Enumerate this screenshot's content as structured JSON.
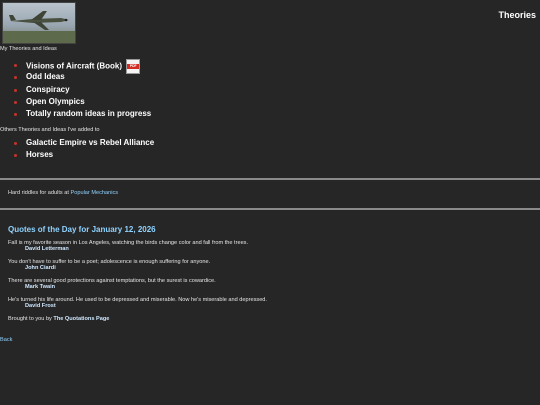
{
  "header": {
    "title": "Theories"
  },
  "my_section": {
    "label": "My Theories and Ideas",
    "items": [
      {
        "label": "Visions of Aircraft (Book)",
        "icon": "pdf-icon"
      },
      {
        "label": "Odd Ideas"
      },
      {
        "label": "Conspiracy"
      },
      {
        "label": "Open Olympics"
      },
      {
        "label": "Totally random ideas in progress"
      }
    ]
  },
  "others_section": {
    "label": "Others Theories and Ideas I've added to",
    "items": [
      {
        "label": "Galactic Empire vs Rebel Alliance"
      },
      {
        "label": "Horses"
      }
    ]
  },
  "riddles": {
    "prefix": "Hard riddles for adults at ",
    "link": "Popular Mechanics"
  },
  "quotes": {
    "title": "Quotes of the Day for January 12, 2026",
    "items": [
      {
        "text": "Fall is my favorite season in Los Angeles, watching the birds change color and fall from the trees.",
        "author": "David Letterman"
      },
      {
        "text": "You don't have to suffer to be a poet; adolescence is enough suffering for anyone.",
        "author": "John Ciardi"
      },
      {
        "text": "There are several good protections against temptations, but the surest is cowardice.",
        "author": "Mark Twain"
      },
      {
        "text": "He's turned his life around. He used to be depressed and miserable. Now he's miserable and depressed.",
        "author": "David Frost"
      }
    ],
    "credit_prefix": "Brought to you by ",
    "credit_link": "The Quotations Page"
  },
  "footer": {
    "back": "Back"
  },
  "colors": {
    "background": "#262626",
    "link": "#8fd3ff",
    "bullet": "#c7322a"
  }
}
